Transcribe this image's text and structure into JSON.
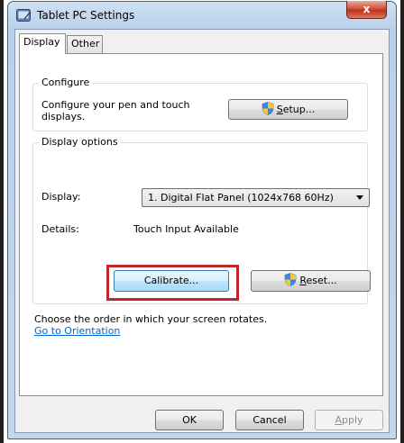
{
  "window": {
    "title": "Tablet PC Settings",
    "close_glyph": "x"
  },
  "tabs": [
    {
      "label": "Display",
      "selected": true
    },
    {
      "label": "Other",
      "selected": false
    }
  ],
  "configure": {
    "legend": "Configure",
    "description": "Configure your pen and touch displays.",
    "setup_button": {
      "prefix": "",
      "accel": "S",
      "suffix": "etup...",
      "icon": "uac-shield-icon"
    }
  },
  "display_options": {
    "legend": "Display options",
    "display_label": "Display:",
    "display_value": "1. Digital Flat Panel (1024x768 60Hz)",
    "details_label": "Details:",
    "details_value": "Touch Input Available",
    "calibrate_button": "Calibrate...",
    "reset_button": {
      "prefix": "",
      "accel": "R",
      "suffix": "eset...",
      "icon": "uac-shield-icon"
    }
  },
  "rotation": {
    "text": "Choose the order in which your screen rotates.",
    "link": "Go to Orientation"
  },
  "footer": {
    "ok": "OK",
    "cancel": "Cancel",
    "apply_accel": "A",
    "apply_suffix": "pply"
  },
  "colors": {
    "highlight_border": "#c0272d",
    "link": "#0066cc",
    "close_button": "#c0311c"
  }
}
